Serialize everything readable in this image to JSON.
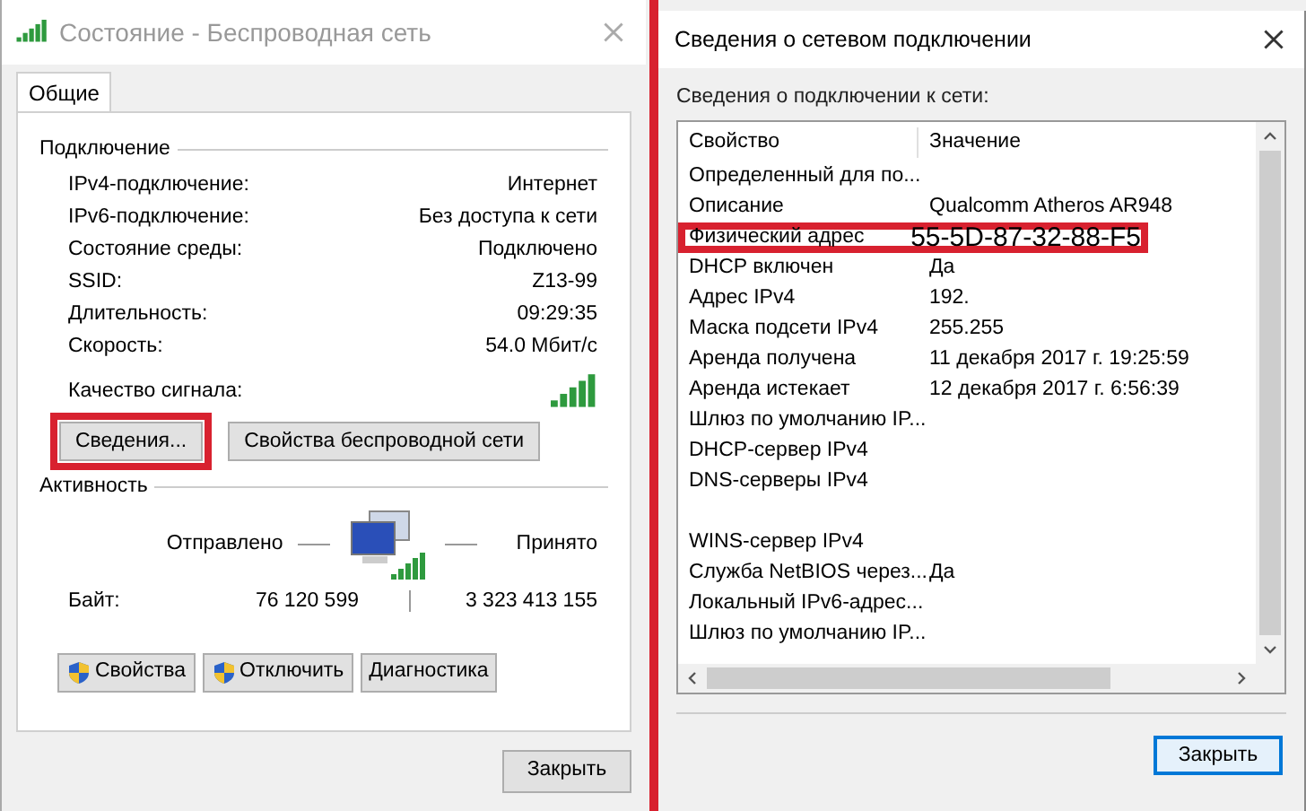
{
  "status_window": {
    "title": "Состояние - Беспроводная сеть",
    "tabs": [
      {
        "label": "Общие",
        "selected": true
      }
    ],
    "connection": {
      "heading": "Подключение",
      "rows": [
        {
          "label": "IPv4-подключение:",
          "value": "Интернет"
        },
        {
          "label": "IPv6-подключение:",
          "value": "Без доступа к сети"
        },
        {
          "label": "Состояние среды:",
          "value": "Подключено"
        },
        {
          "label": "SSID:",
          "value": "Z13-99"
        },
        {
          "label": "Длительность:",
          "value": "09:29:35"
        },
        {
          "label": "Скорость:",
          "value": "54.0 Мбит/с"
        }
      ],
      "signal_label": "Качество сигнала:"
    },
    "buttons": [
      {
        "label": "Сведения...",
        "highlighted": true
      },
      {
        "label": "Свойства беспроводной сети",
        "highlighted": false
      }
    ],
    "activity": {
      "heading": "Активность",
      "sent_label": "Отправлено",
      "received_label": "Принято",
      "bytes_label": "Байт:",
      "sent": "76 120 599",
      "received": "3 323 413 155"
    },
    "actions": [
      {
        "label": "Свойства",
        "shield": true
      },
      {
        "label": "Отключить",
        "shield": true
      },
      {
        "label": "Диагностика",
        "shield": false
      }
    ],
    "close": "Закрыть"
  },
  "details_window": {
    "title": "Сведения о сетевом подключении",
    "caption": "Сведения о подключении к сети:",
    "columns": [
      "Свойство",
      "Значение"
    ],
    "rows": [
      {
        "property": "Определенный для по...",
        "value": "",
        "highlighted": false
      },
      {
        "property": "Описание",
        "value": "Qualcomm Atheros AR948",
        "highlighted": false
      },
      {
        "property": "Физический адрес",
        "value": "55-5D-87-32-88-F5",
        "highlighted": true
      },
      {
        "property": "DHCP включен",
        "value": "Да",
        "highlighted": false
      },
      {
        "property": "Адрес IPv4",
        "value": "192.",
        "highlighted": false
      },
      {
        "property": "Маска подсети IPv4",
        "value": "255.255",
        "highlighted": false
      },
      {
        "property": "Аренда получена",
        "value": "11 декабря 2017 г. 19:25:59",
        "highlighted": false
      },
      {
        "property": "Аренда истекает",
        "value": "12 декабря 2017 г. 6:56:39",
        "highlighted": false
      },
      {
        "property": "Шлюз по умолчанию IP...",
        "value": "",
        "highlighted": false
      },
      {
        "property": "DHCP-сервер IPv4",
        "value": "",
        "highlighted": false
      },
      {
        "property": "DNS-серверы IPv4",
        "value": "",
        "highlighted": false
      },
      {
        "property": "",
        "value": "",
        "highlighted": false
      },
      {
        "property": "WINS-сервер IPv4",
        "value": "",
        "highlighted": false
      },
      {
        "property": "Служба NetBIOS через...",
        "value": "Да",
        "highlighted": false
      },
      {
        "property": "Локальный IPv6-адрес...",
        "value": "",
        "highlighted": false
      },
      {
        "property": "Шлюз по умолчанию IP...",
        "value": "",
        "highlighted": false
      }
    ],
    "close": "Закрыть"
  }
}
